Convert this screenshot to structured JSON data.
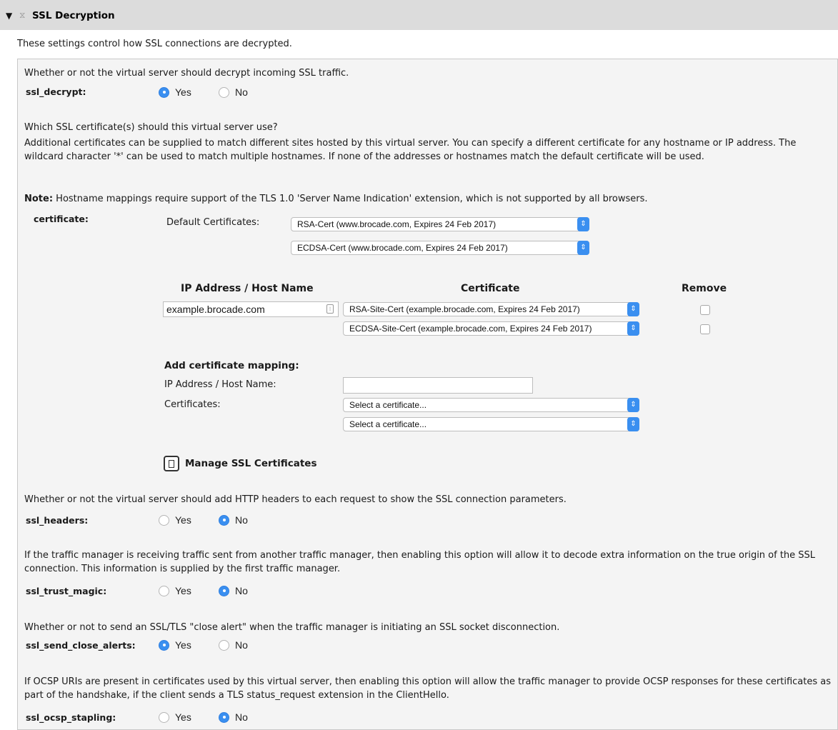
{
  "section": {
    "title": "SSL Decryption",
    "intro": "These settings control how SSL connections are decrypted."
  },
  "ssl_decrypt": {
    "description": "Whether or not the virtual server should decrypt incoming SSL traffic.",
    "label": "ssl_decrypt:",
    "selected": "Yes"
  },
  "radio_labels": {
    "yes": "Yes",
    "no": "No"
  },
  "certificate": {
    "question": "Which SSL certificate(s) should this virtual server use?",
    "description": "Additional certificates can be supplied to match different sites hosted by this virtual server. You can specify a different certificate for any hostname or IP address. The wildcard character '*' can be used to match multiple hostnames. If none of the addresses or hostnames match the default certificate will be used.",
    "note_label": "Note:",
    "note_text": " Hostname mappings require support of the TLS 1.0 'Server Name Indication' extension, which is not supported by all browsers.",
    "label": "certificate:",
    "default_label": "Default Certificates:",
    "default_certs": [
      "RSA-Cert (www.brocade.com, Expires 24 Feb 2017)",
      "ECDSA-Cert (www.brocade.com, Expires 24 Feb 2017)"
    ],
    "table_headers": {
      "host": "IP Address / Host Name",
      "cert": "Certificate",
      "remove": "Remove"
    },
    "mapping": {
      "host": "example.brocade.com",
      "certs": [
        "RSA-Site-Cert (example.brocade.com, Expires 24 Feb 2017)",
        "ECDSA-Site-Cert (example.brocade.com, Expires 24 Feb 2017)"
      ]
    },
    "add_mapping": {
      "title": "Add certificate mapping:",
      "host_label": "IP Address / Host Name:",
      "certs_label": "Certificates:",
      "select_placeholder": "Select a certificate..."
    },
    "manage_label": "Manage SSL Certificates"
  },
  "ssl_headers": {
    "description": "Whether or not the virtual server should add HTTP headers to each request to show the SSL connection parameters.",
    "label": "ssl_headers:",
    "selected": "No"
  },
  "ssl_trust_magic": {
    "description": "If the traffic manager is receiving traffic sent from another traffic manager, then enabling this option will allow it to decode extra information on the true origin of the SSL connection. This information is supplied by the first traffic manager.",
    "label": "ssl_trust_magic:",
    "selected": "No"
  },
  "ssl_send_close_alerts": {
    "description": "Whether or not to send an SSL/TLS \"close alert\" when the traffic manager is initiating an SSL socket disconnection.",
    "label": "ssl_send_close_alerts:",
    "selected": "Yes"
  },
  "ssl_ocsp_stapling": {
    "description": "If OCSP URIs are present in certificates used by this virtual server, then enabling this option will allow the traffic manager to provide OCSP responses for these certificates as part of the handshake, if the client sends a TLS status_request extension in the ClientHello.",
    "label": "ssl_ocsp_stapling:",
    "selected": "No"
  },
  "colors": {
    "accent": "#3a8ff0",
    "header_bg": "#dcdcdc",
    "panel_bg": "#f4f4f4"
  }
}
